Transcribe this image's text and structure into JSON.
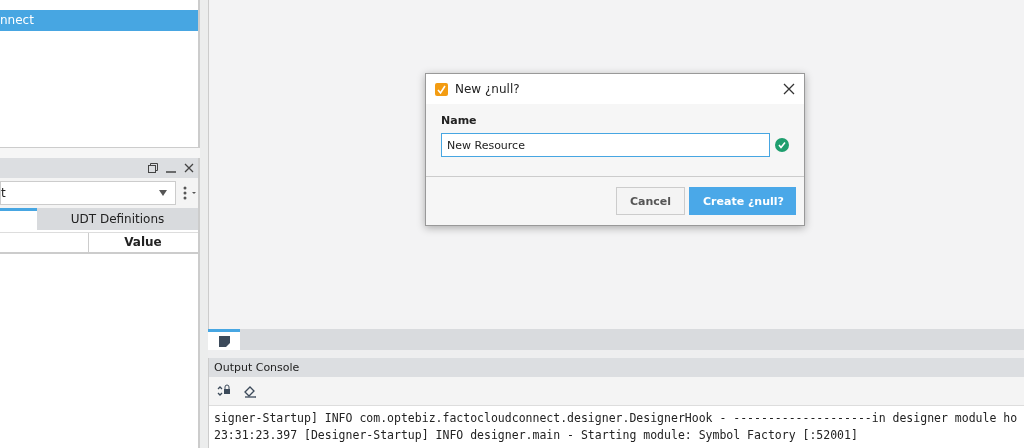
{
  "project_tree": {
    "items": [
      {
        "label": "nnect",
        "selected": true
      }
    ]
  },
  "tag_browser": {
    "provider": "t",
    "tabs": [
      {
        "selected": true
      },
      {
        "label": "UDT Definitions",
        "selected": false
      }
    ],
    "columns": [
      "Value"
    ]
  },
  "workspace_tabs": [
    {
      "selected": true
    }
  ],
  "output_console": {
    "title": "Output Console",
    "lines": [
      "signer-Startup] INFO com.optebiz.factocloudconnect.designer.DesignerHook - --------------------in designer module ho",
      "23:31:23.397 [Designer-Startup] INFO designer.main - Starting module: Symbol Factory [:52001]"
    ]
  },
  "dialog": {
    "title": "New ¿null?",
    "field_label": "Name",
    "value": "New Resource",
    "valid": true,
    "buttons": [
      {
        "label": "Cancel",
        "kind": "secondary"
      },
      {
        "label": "Create ¿null?",
        "kind": "primary"
      }
    ]
  }
}
